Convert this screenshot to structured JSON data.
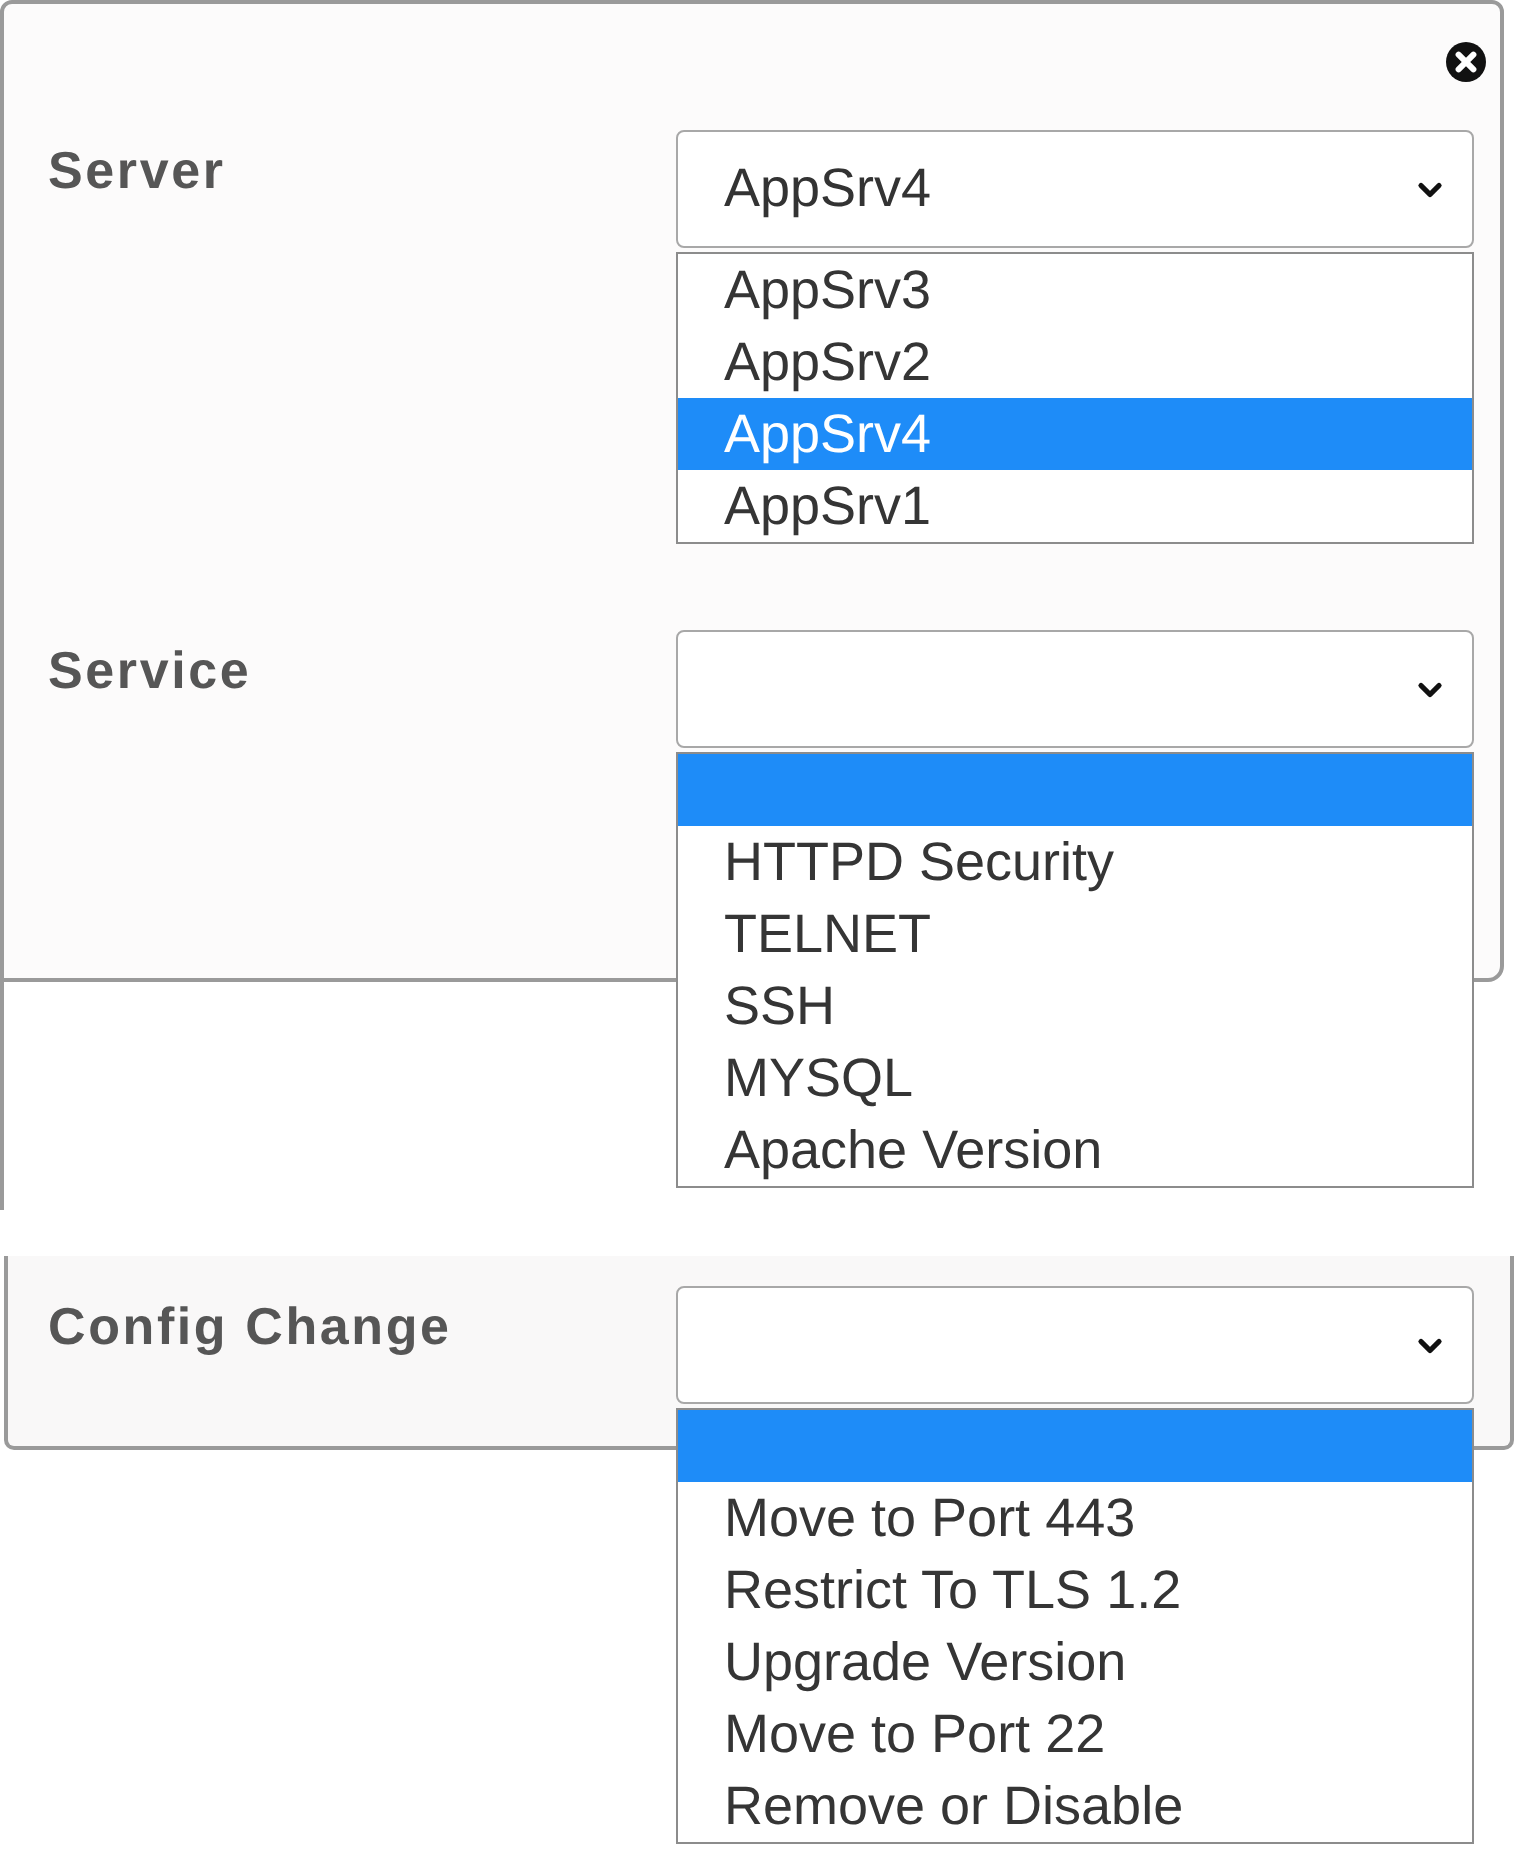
{
  "panels": [
    {
      "fields": [
        {
          "label": "Server",
          "value": "AppSrv4",
          "expanded": true,
          "options": [
            {
              "label": "AppSrv3",
              "selected": false
            },
            {
              "label": "AppSrv2",
              "selected": false
            },
            {
              "label": "AppSrv4",
              "selected": true
            },
            {
              "label": "AppSrv1",
              "selected": false
            }
          ]
        },
        {
          "label": "Service",
          "expanded": true,
          "options": [
            {
              "selected": true
            },
            {
              "label": "HTTPD Security",
              "selected": false
            },
            {
              "label": "TELNET",
              "selected": false
            },
            {
              "label": "SSH",
              "selected": false
            },
            {
              "label": "MYSQL",
              "selected": false
            },
            {
              "label": "Apache Version",
              "selected": false
            }
          ]
        }
      ]
    },
    {
      "fields": [
        {
          "label": "Config Change",
          "expanded": true,
          "options": [
            {
              "selected": true
            },
            {
              "label": "Move to Port 443",
              "selected": false
            },
            {
              "label": "Restrict To TLS 1.2",
              "selected": false
            },
            {
              "label": "Upgrade Version",
              "selected": false
            },
            {
              "label": "Move to Port 22",
              "selected": false
            },
            {
              "label": "Remove or Disable",
              "selected": false
            }
          ]
        }
      ]
    }
  ]
}
